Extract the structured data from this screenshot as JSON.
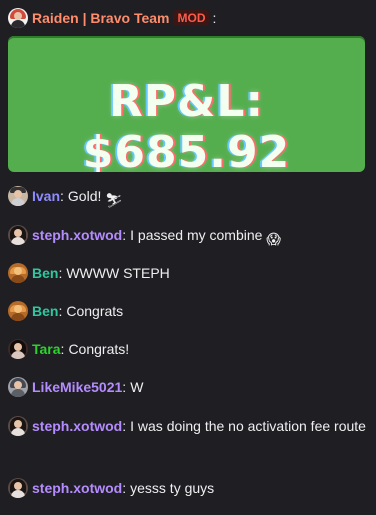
{
  "colors": {
    "background": "#1f1f23",
    "text": "#efeff1",
    "embed_green": "#54ae4e",
    "mod_badge_text": "#ff5a4a"
  },
  "header_message": {
    "user": "Raiden | Bravo Team",
    "badge": "MOD",
    "colon": ":",
    "user_color": "#ff8c6b",
    "embed_text": "RP&L: $685.92"
  },
  "messages": [
    {
      "user": "Ivan",
      "user_color": "#8e8cff",
      "colon": ":",
      "text": "Gold!",
      "emoji": "⛷"
    },
    {
      "user": "steph.xotwod",
      "user_color": "#b58cff",
      "colon": ":",
      "text": "I passed my combine",
      "emoji": "😱"
    },
    {
      "user": "Ben",
      "user_color": "#2fc7a0",
      "colon": ":",
      "text": "WWWW STEPH",
      "emoji": ""
    },
    {
      "user": "Ben",
      "user_color": "#2fc7a0",
      "colon": ":",
      "text": "Congrats",
      "emoji": ""
    },
    {
      "user": "Tara",
      "user_color": "#2ed12e",
      "colon": ":",
      "text": "Congrats!",
      "emoji": ""
    },
    {
      "user": "LikeMike5021",
      "user_color": "#b58cff",
      "colon": ":",
      "text": "W",
      "emoji": ""
    },
    {
      "user": "steph.xotwod",
      "user_color": "#b58cff",
      "colon": ":",
      "text": "I was doing the no activation fee route",
      "emoji": ""
    },
    {
      "user": "steph.xotwod",
      "user_color": "#b58cff",
      "colon": ":",
      "text": "yesss ty guys",
      "emoji": ""
    }
  ]
}
